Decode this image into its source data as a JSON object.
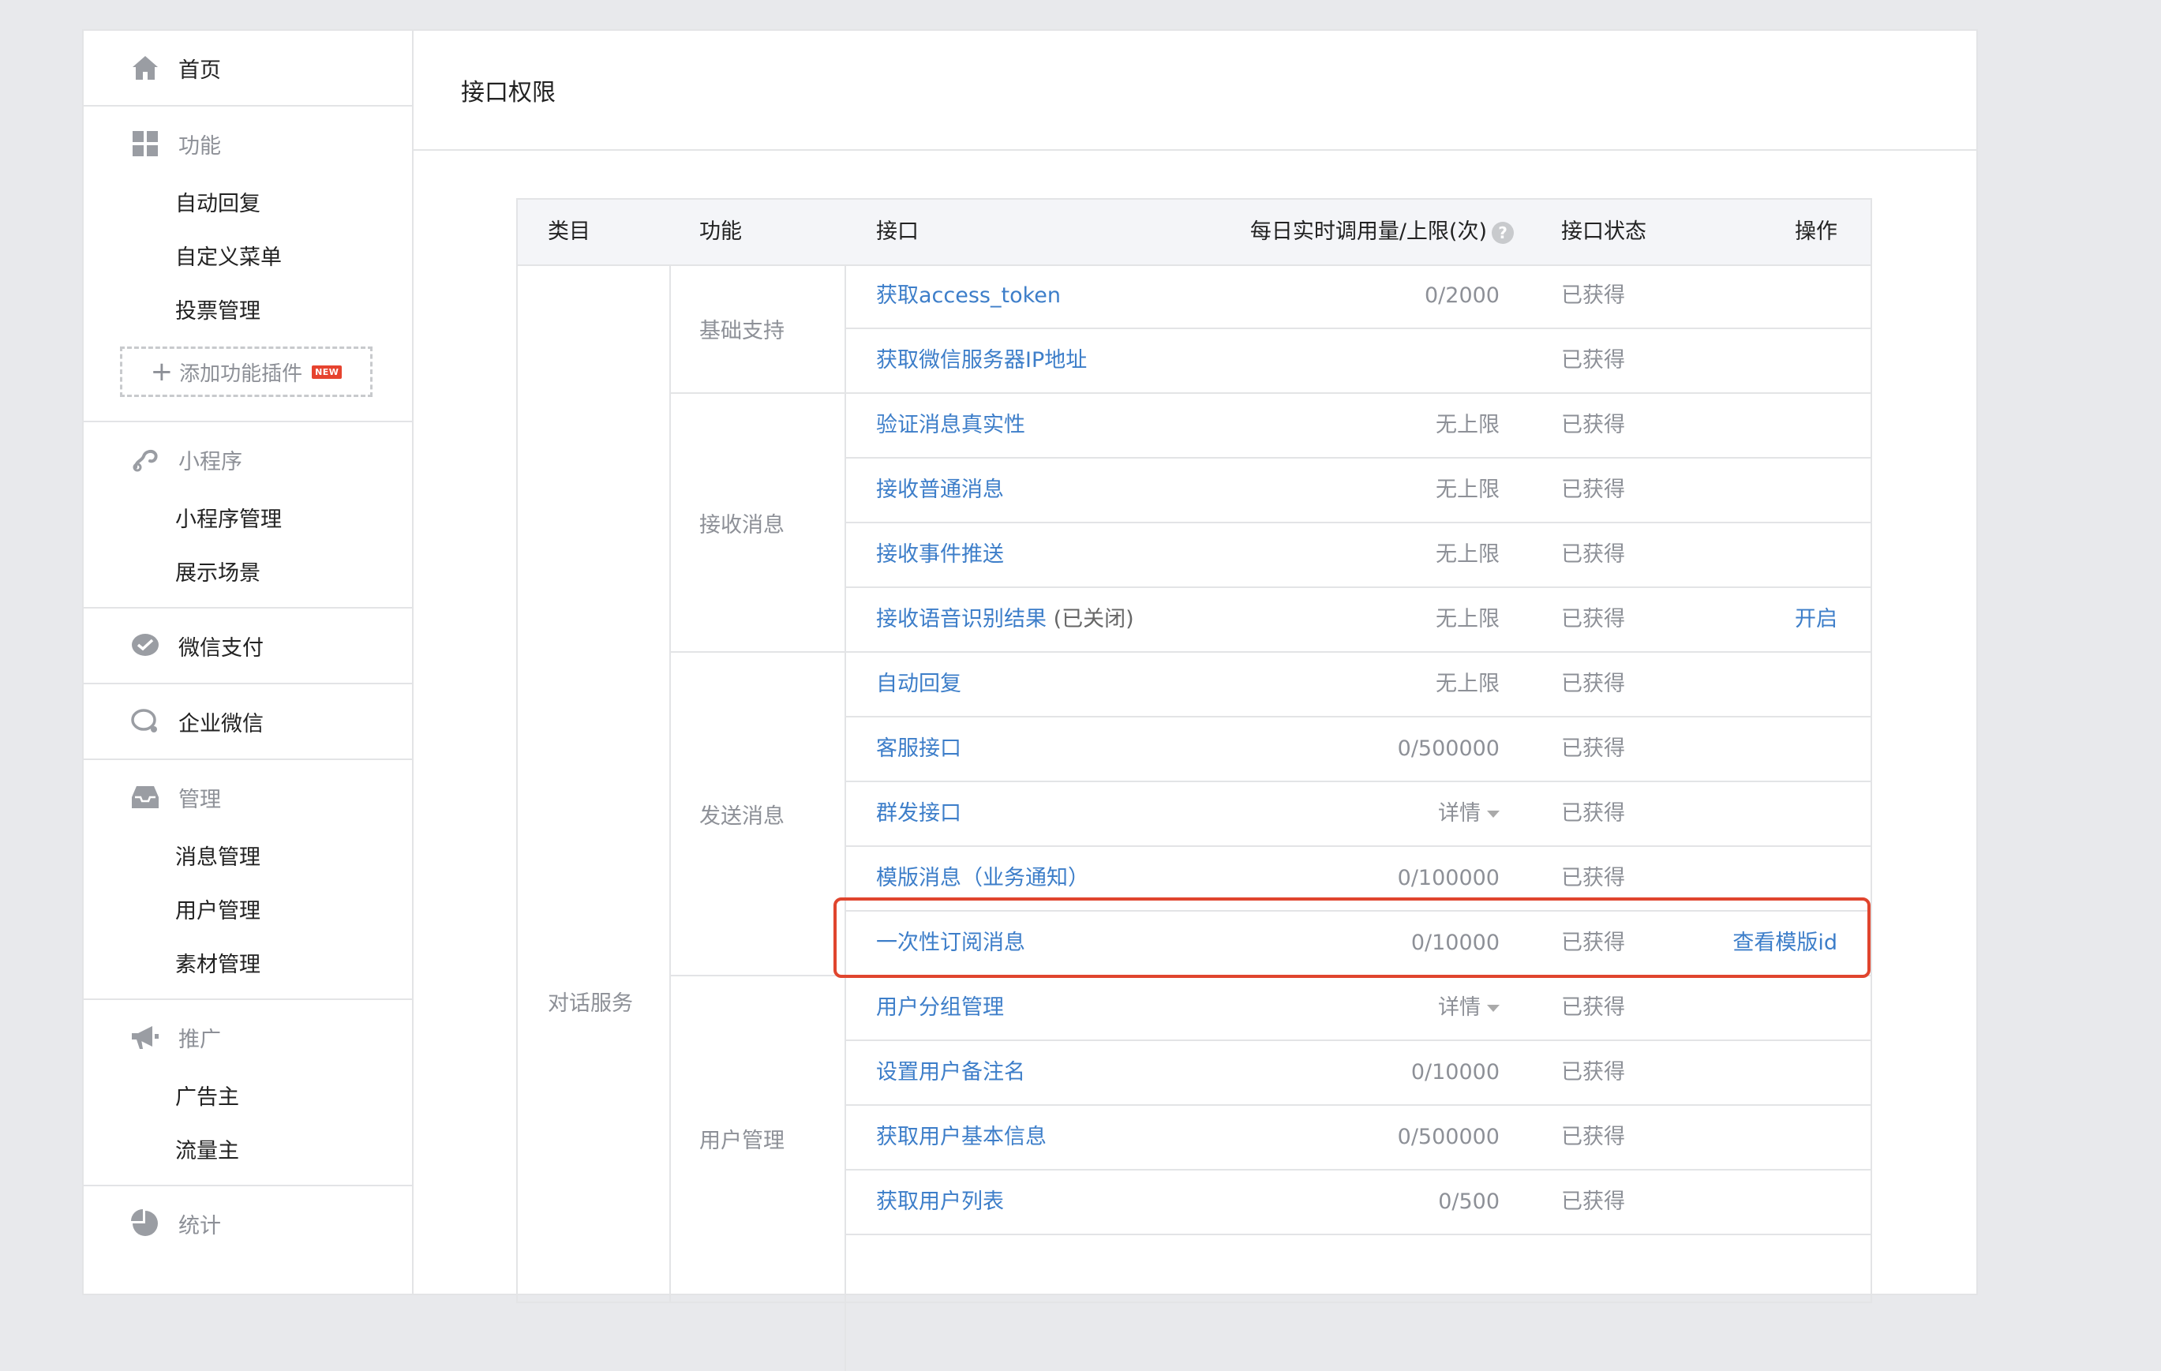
{
  "sidebar": {
    "home": "首页",
    "function": {
      "title": "功能",
      "items": [
        "自动回复",
        "自定义菜单",
        "投票管理"
      ],
      "add_plugin": "添加功能插件",
      "badge": "NEW"
    },
    "miniprogram": {
      "title": "小程序",
      "items": [
        "小程序管理",
        "展示场景"
      ]
    },
    "wechat_pay": "微信支付",
    "work_wechat": "企业微信",
    "manage": {
      "title": "管理",
      "items": [
        "消息管理",
        "用户管理",
        "素材管理"
      ]
    },
    "promote": {
      "title": "推广",
      "items": [
        "广告主",
        "流量主"
      ]
    },
    "stats": {
      "title": "统计"
    }
  },
  "main": {
    "title": "接口权限",
    "table": {
      "headers": {
        "category": "类目",
        "function": "功能",
        "api": "接口",
        "quota": "每日实时调用量/上限(次)",
        "help": "?",
        "status": "接口状态",
        "action": "操作"
      },
      "category": "对话服务",
      "groups": [
        "基础支持",
        "接收消息",
        "发送消息",
        "用户管理"
      ],
      "rows": [
        {
          "api": "获取access_token",
          "suffix": "",
          "quota": "0/2000",
          "status": "已获得",
          "action": ""
        },
        {
          "api": "获取微信服务器IP地址",
          "suffix": "",
          "quota": "",
          "status": "已获得",
          "action": ""
        },
        {
          "api": "验证消息真实性",
          "suffix": "",
          "quota": "无上限",
          "status": "已获得",
          "action": ""
        },
        {
          "api": "接收普通消息",
          "suffix": "",
          "quota": "无上限",
          "status": "已获得",
          "action": ""
        },
        {
          "api": "接收事件推送",
          "suffix": "",
          "quota": "无上限",
          "status": "已获得",
          "action": ""
        },
        {
          "api": "接收语音识别结果",
          "suffix": " (已关闭)",
          "quota": "无上限",
          "status": "已获得",
          "action": "开启"
        },
        {
          "api": "自动回复",
          "suffix": "",
          "quota": "无上限",
          "status": "已获得",
          "action": ""
        },
        {
          "api": "客服接口",
          "suffix": "",
          "quota": "0/500000",
          "status": "已获得",
          "action": ""
        },
        {
          "api": "群发接口",
          "suffix": "",
          "quota": "详情",
          "status": "已获得",
          "action": ""
        },
        {
          "api": "模版消息（业务通知）",
          "suffix": "",
          "quota": "0/100000",
          "status": "已获得",
          "action": ""
        },
        {
          "api": "一次性订阅消息",
          "suffix": "",
          "quota": "0/10000",
          "status": "已获得",
          "action": "查看模版id"
        },
        {
          "api": "用户分组管理",
          "suffix": "",
          "quota": "详情",
          "status": "已获得",
          "action": ""
        },
        {
          "api": "设置用户备注名",
          "suffix": "",
          "quota": "0/10000",
          "status": "已获得",
          "action": ""
        },
        {
          "api": "获取用户基本信息",
          "suffix": "",
          "quota": "0/500000",
          "status": "已获得",
          "action": ""
        },
        {
          "api": "获取用户列表",
          "suffix": "",
          "quota": "0/500",
          "status": "已获得",
          "action": ""
        }
      ]
    }
  },
  "colors": {
    "link": "#3d7ec9",
    "highlight": "#e0452e"
  }
}
